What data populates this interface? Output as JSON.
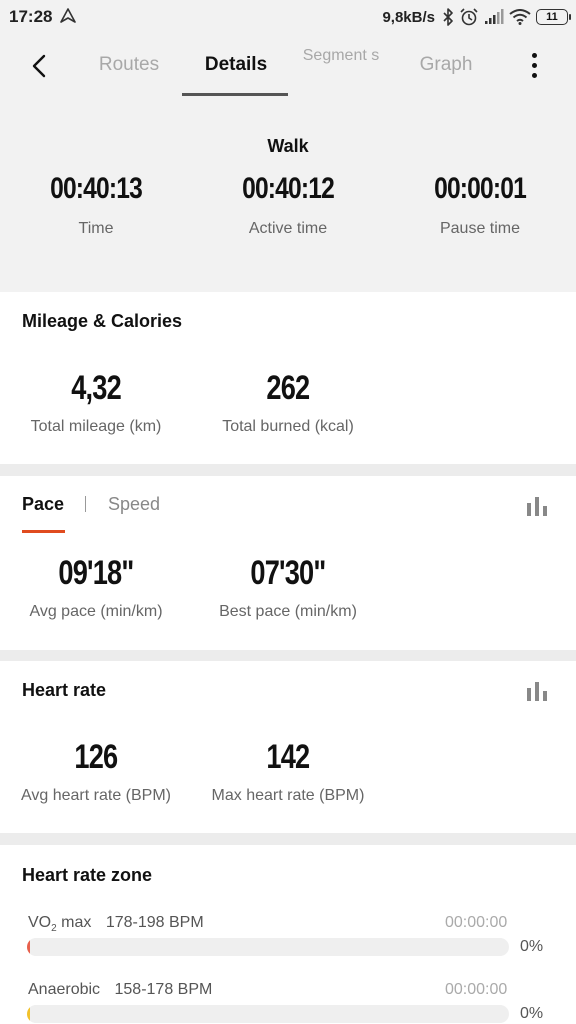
{
  "status_bar": {
    "time": "17:28",
    "net_speed": "9,8kB/s",
    "battery": "11",
    "icons": [
      "navigation-icon",
      "bluetooth-icon",
      "alarm-icon",
      "signal-icon",
      "wifi-icon",
      "battery-icon"
    ]
  },
  "tabs": {
    "routes": "Routes",
    "details": "Details",
    "segments": "Segment s",
    "graph": "Graph",
    "active": "Details"
  },
  "summary": {
    "activity": "Walk",
    "time": {
      "value": "00:40:13",
      "label": "Time"
    },
    "active_time": {
      "value": "00:40:12",
      "label": "Active time"
    },
    "pause_time": {
      "value": "00:00:01",
      "label": "Pause time"
    }
  },
  "mileage": {
    "title": "Mileage & Calories",
    "total_mileage": {
      "value": "4,32",
      "label": "Total mileage (km)"
    },
    "total_burned": {
      "value": "262",
      "label": "Total burned (kcal)"
    }
  },
  "pace": {
    "tab_pace": "Pace",
    "tab_speed": "Speed",
    "active_tab": "Pace",
    "avg_pace": {
      "value": "09'18\"",
      "label": "Avg pace (min/km)"
    },
    "best_pace": {
      "value": "07'30\"",
      "label": "Best pace (min/km)"
    }
  },
  "heart_rate": {
    "title": "Heart rate",
    "avg": {
      "value": "126",
      "label": "Avg heart rate (BPM)"
    },
    "max": {
      "value": "142",
      "label": "Max heart rate (BPM)"
    }
  },
  "hr_zone": {
    "title": "Heart rate zone",
    "zones": [
      {
        "name": "VO",
        "sub": "2",
        "name_suffix": " max",
        "range": "178-198 BPM",
        "time": "00:00:00",
        "percent": "0%",
        "fraction": 0,
        "color": "#e8604c"
      },
      {
        "name": "Anaerobic",
        "sub": "",
        "name_suffix": "",
        "range": "158-178 BPM",
        "time": "00:00:00",
        "percent": "0%",
        "fraction": 0,
        "color": "#f2c22b"
      }
    ]
  },
  "colors": {
    "accent": "#e04b1f",
    "background": "#ececec",
    "card": "#ffffff"
  }
}
